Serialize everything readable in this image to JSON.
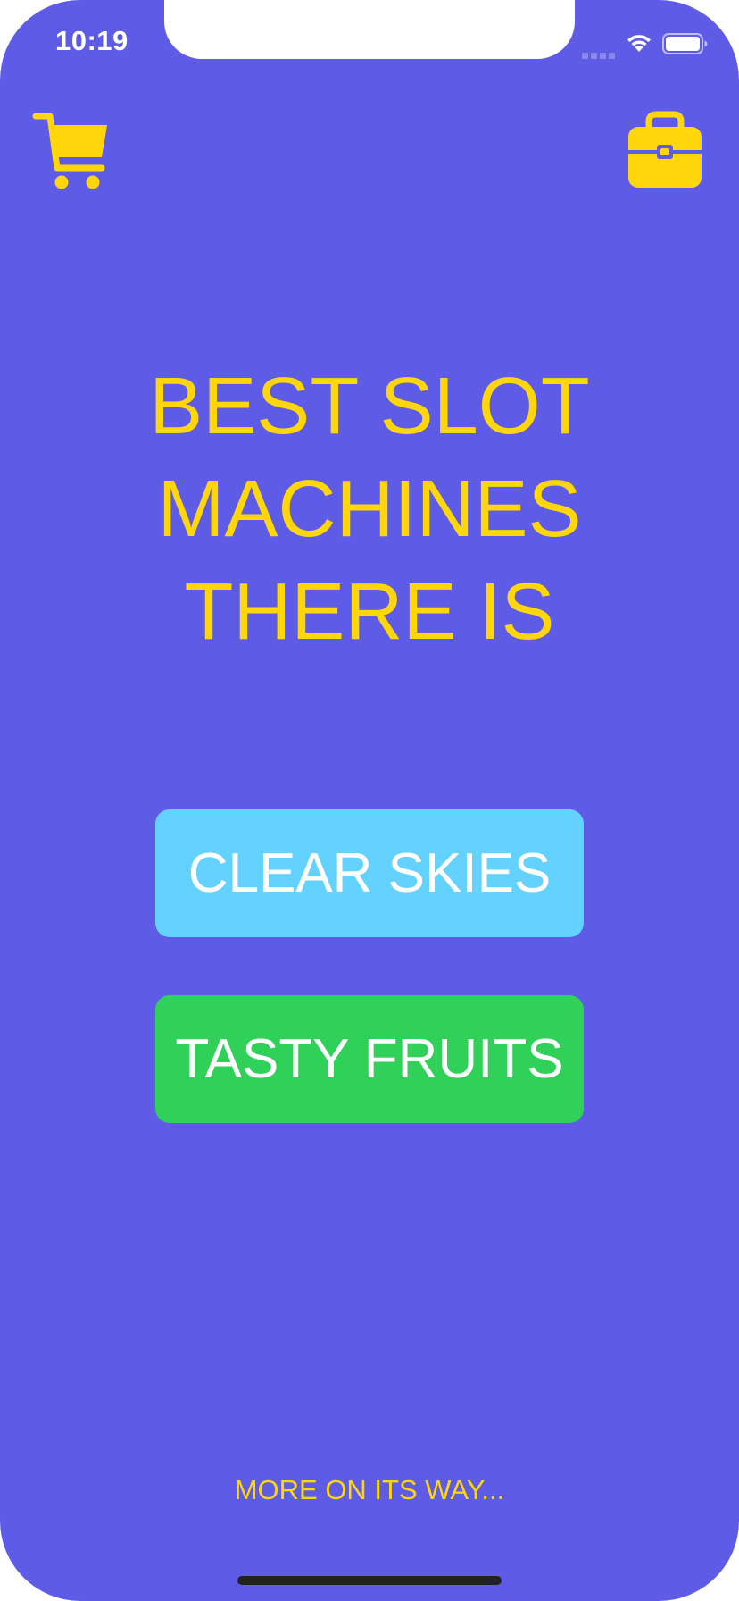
{
  "status_bar": {
    "time": "10:19",
    "signal_icon": "cellular-signal-icon",
    "wifi_icon": "wifi-icon",
    "battery_icon": "battery-icon"
  },
  "toolbar": {
    "left_icon": "shopping-cart-icon",
    "right_icon": "briefcase-icon"
  },
  "headline": {
    "lines": [
      "BEST SLOT",
      "MACHINES",
      "THERE IS"
    ]
  },
  "buttons": {
    "clear_skies": "CLEAR SKIES",
    "tasty_fruits": "TASTY FRUITS"
  },
  "footer": {
    "text": "MORE ON ITS WAY..."
  },
  "colors": {
    "background": "#5e5ce6",
    "accent": "#ffd60a",
    "clear_skies": "#64d2ff",
    "tasty_fruits": "#30d158"
  }
}
